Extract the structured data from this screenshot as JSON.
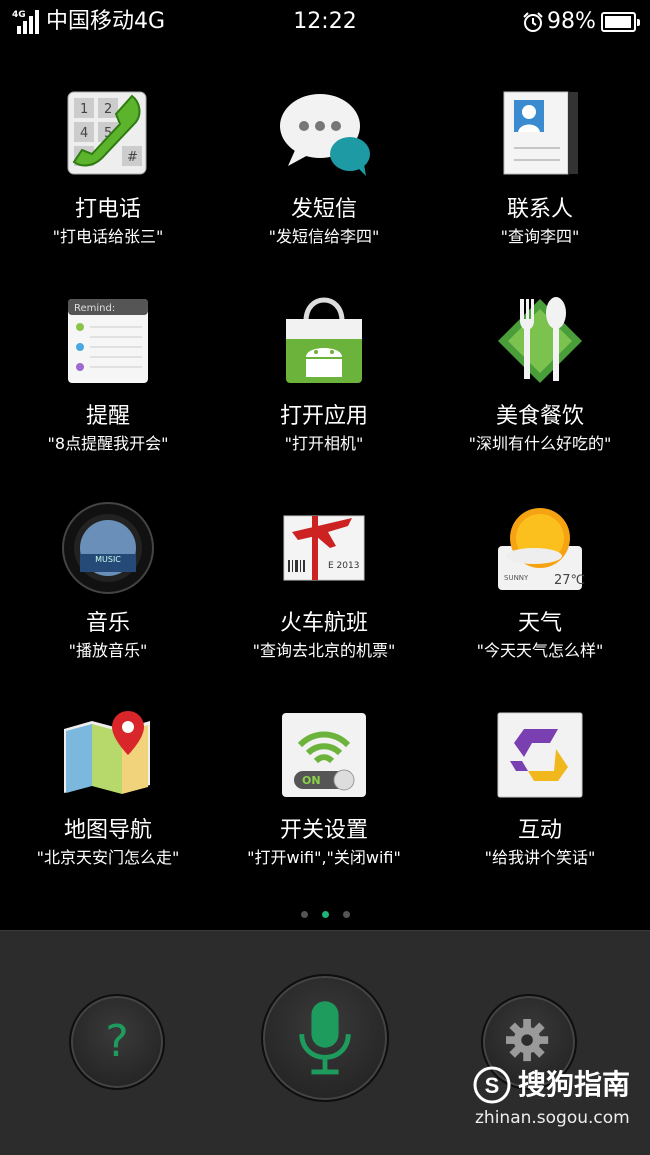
{
  "status_bar": {
    "network_tag": "4G",
    "carrier": "中国移动4G",
    "time": "12:22",
    "battery_percent": "98%",
    "battery_level": 0.98
  },
  "commands": [
    {
      "title": "打电话",
      "example": "\"打电话给张三\"",
      "icon": "phone-dialer-icon"
    },
    {
      "title": "发短信",
      "example": "\"发短信给李四\"",
      "icon": "message-bubbles-icon"
    },
    {
      "title": "联系人",
      "example": "\"查询李四\"",
      "icon": "contacts-card-icon"
    },
    {
      "title": "提醒",
      "example": "\"8点提醒我开会\"",
      "icon": "reminder-list-icon",
      "icon_text": "Remind:"
    },
    {
      "title": "打开应用",
      "example": "\"打开相机\"",
      "icon": "android-bag-icon"
    },
    {
      "title": "美食餐饮",
      "example": "\"深圳有什么好吃的\"",
      "icon": "fork-spoon-icon"
    },
    {
      "title": "音乐",
      "example": "\"播放音乐\"",
      "icon": "music-disc-icon",
      "icon_text": "MUSIC"
    },
    {
      "title": "火车航班",
      "example": "\"查询去北京的机票\"",
      "icon": "flight-ticket-icon",
      "icon_text": "E 2013"
    },
    {
      "title": "天气",
      "example": "\"今天天气怎么样\"",
      "icon": "sunny-weather-icon",
      "icon_text": "SUNNY",
      "icon_temp": "27℃"
    },
    {
      "title": "地图导航",
      "example": "\"北京天安门怎么走\"",
      "icon": "map-pin-icon"
    },
    {
      "title": "开关设置",
      "example": "\"打开wifi\",\"关闭wifi\"",
      "icon": "wifi-toggle-icon",
      "icon_text": "ON"
    },
    {
      "title": "互动",
      "example": "\"给我讲个笑话\"",
      "icon": "interact-arrows-icon"
    }
  ],
  "pager": {
    "pages": 3,
    "active": 2
  },
  "bottom": {
    "help_label": "?"
  },
  "watermark": {
    "logo_letter": "S",
    "brand": "搜狗指南",
    "url": "zhinan.sogou.com"
  },
  "colors": {
    "accent_green": "#1fb37a",
    "bottom_bar": "#2c2c2c"
  }
}
